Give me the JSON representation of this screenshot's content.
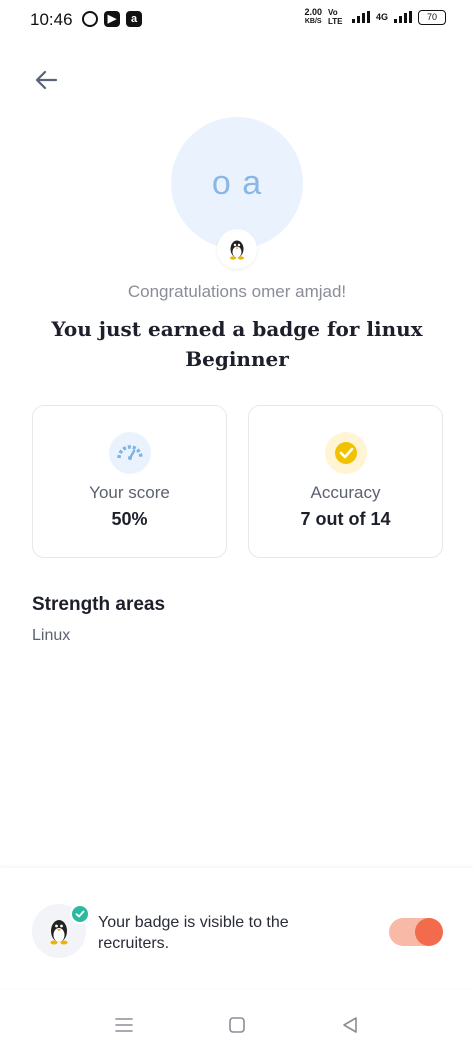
{
  "status_bar": {
    "time": "10:46",
    "net_speed_value": "2.00",
    "net_speed_unit": "KB/S",
    "volte": "Vo LTE",
    "network": "4G",
    "battery": "70"
  },
  "profile": {
    "initials": "o a",
    "badge_icon": "linux-penguin-icon"
  },
  "congrats_text": "Congratulations omer amjad!",
  "badge_title": "You just earned a badge for linux Beginner",
  "stats": [
    {
      "label": "Your score",
      "value": "50%",
      "icon": "speedometer-icon",
      "icon_bg": "#eaf3fd"
    },
    {
      "label": "Accuracy",
      "value": "7 out of 14",
      "icon": "check-circle-icon",
      "icon_bg": "#fff4d4"
    }
  ],
  "strength": {
    "title": "Strength areas",
    "items": [
      "Linux"
    ]
  },
  "visibility": {
    "text": "Your badge is visible to the recruiters.",
    "toggle_on": true
  },
  "colors": {
    "accent_blue": "#8ab7e6",
    "toggle_active": "#f26b4d",
    "check_green": "#2bb9a0"
  }
}
